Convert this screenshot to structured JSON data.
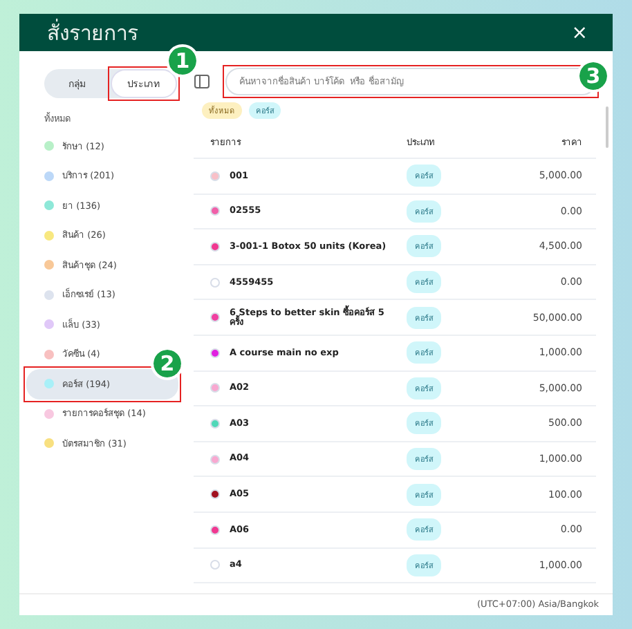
{
  "window": {
    "title": "สั่งรายการ",
    "close": "×"
  },
  "mode_toggle": [
    {
      "label": "กลุ่ม",
      "selected": false
    },
    {
      "label": "ประเภท",
      "selected": true,
      "callout": "1"
    }
  ],
  "sidebar": {
    "heading": "ทั้งหมด",
    "items": [
      {
        "label": "รักษา (12)",
        "color": "#b8f0c8",
        "selected": false
      },
      {
        "label": "บริการ (201)",
        "color": "#bcd8f8",
        "selected": false
      },
      {
        "label": "ยา (136)",
        "color": "#8ee8d8",
        "selected": false
      },
      {
        "label": "สินค้า (26)",
        "color": "#f8e880",
        "selected": false
      },
      {
        "label": "สินค้าชุด (24)",
        "color": "#f8c898",
        "selected": false
      },
      {
        "label": "เอ็กซเรย์ (13)",
        "color": "#dde3ee",
        "selected": false
      },
      {
        "label": "แล็บ (33)",
        "color": "#e0c8f8",
        "selected": false
      },
      {
        "label": "วัคซีน (4)",
        "color": "#f8c0c0",
        "selected": false
      },
      {
        "label": "คอร์ส (194)",
        "color": "#a8f0f8",
        "selected": true,
        "callout": "2"
      },
      {
        "label": "รายการคอร์สชุด (14)",
        "color": "#f8c8e0",
        "selected": false
      },
      {
        "label": "บัตรสมาชิก (31)",
        "color": "#f8e080",
        "selected": false
      }
    ]
  },
  "search": {
    "placeholder": "ค้นหาจากชื่อสินค้า บาร์โค้ด  หรือ ชื่อสามัญ",
    "callout": "3"
  },
  "filter_chips": [
    {
      "label": "ทั้งหมด",
      "color": "#fdf0c0"
    },
    {
      "label": "คอร์ส",
      "color": "#d0f6fa"
    }
  ],
  "table": {
    "columns": [
      "รายการ",
      "ประเภท",
      "ราคา"
    ],
    "rows": [
      {
        "name": "001",
        "color": "#f8c0c8",
        "type": "คอร์ส",
        "price": "5,000.00"
      },
      {
        "name": "02555",
        "color": "#f060a8",
        "type": "คอร์ส",
        "price": "0.00"
      },
      {
        "name": "3-001-1 Botox 50 units (Korea)",
        "color": "#f03890",
        "type": "คอร์ส",
        "price": "4,500.00"
      },
      {
        "name": "4559455",
        "color": "#ffffff",
        "type": "คอร์ส",
        "price": "0.00"
      },
      {
        "name": "6 Steps to better skin ซื้อคอร์ส 5 ครั้ง",
        "color": "#f040a0",
        "type": "คอร์ส",
        "price": "50,000.00"
      },
      {
        "name": "A course main no exp",
        "color": "#e020e0",
        "type": "คอร์ส",
        "price": "1,000.00"
      },
      {
        "name": "A02",
        "color": "#f8a8d0",
        "type": "คอร์ส",
        "price": "5,000.00"
      },
      {
        "name": "A03",
        "color": "#50d8b8",
        "type": "คอร์ส",
        "price": "500.00"
      },
      {
        "name": "A04",
        "color": "#f8a8d0",
        "type": "คอร์ส",
        "price": "1,000.00"
      },
      {
        "name": "A05",
        "color": "#a01020",
        "type": "คอร์ส",
        "price": "100.00"
      },
      {
        "name": "A06",
        "color": "#f03890",
        "type": "คอร์ส",
        "price": "0.00"
      },
      {
        "name": "a4",
        "color": "#ffffff",
        "type": "คอร์ส",
        "price": "1,000.00"
      }
    ]
  },
  "status_bar": "(UTC+07:00) Asia/Bangkok"
}
